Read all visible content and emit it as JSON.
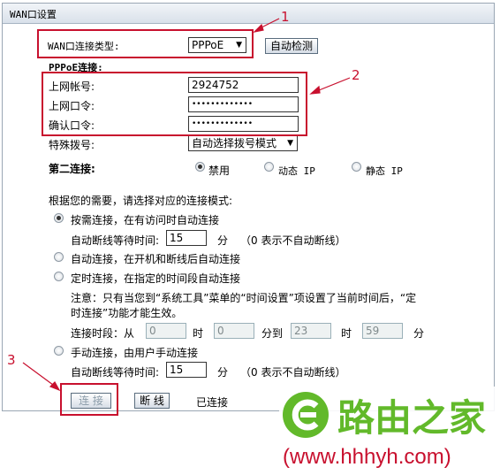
{
  "window": {
    "title": "WAN口设置"
  },
  "wan_type": {
    "label": "WAN口连接类型:",
    "value": "PPPoE",
    "detect_button": "自动检测"
  },
  "pppoe": {
    "section_label": "PPPoE连接:",
    "account_label": "上网帐号:",
    "account_value": "2924752",
    "password_label": "上网口令:",
    "password_value": "•••••••••••••",
    "confirm_label": "确认口令:",
    "confirm_value": "•••••••••••••",
    "dial_label": "特殊拨号:",
    "dial_value": "自动选择拨号模式"
  },
  "second_conn": {
    "label": "第二连接:",
    "options": [
      "禁用",
      "动态 IP",
      "静态 IP"
    ],
    "selected": "禁用"
  },
  "mode": {
    "prompt": "根据您的需要，请选择对应的连接模式:",
    "on_demand": "按需连接，在有访问时自动连接",
    "idle_label": "自动断线等待时间:",
    "idle_value": "15",
    "idle_unit": "分",
    "idle_note": "（0 表示不自动断线）",
    "auto": "自动连接，在开机和断线后自动连接",
    "timed": "定时连接，在指定的时间段自动连接",
    "timed_note_line1": "注意：只有当您到“系统工具”菜单的“时间设置”项设置了当前时间后，“定",
    "timed_note_line2": "时连接”功能才能生效。",
    "period_label": "连接时段：从",
    "period_from_h": "0",
    "period_unit_h": "时",
    "period_from_m": "0",
    "period_to_label": "分到",
    "period_to_h": "23",
    "period_to_m": "59",
    "period_unit_m": "分",
    "manual": "手动连接，由用户手动连接",
    "manual_idle_value": "15"
  },
  "actions": {
    "connect": "连 接",
    "disconnect": "断 线",
    "status": "已连接"
  },
  "annotations": [
    "1",
    "2",
    "3"
  ],
  "watermark": {
    "brand": "路由之家",
    "url": "(www.hhhyh.com)"
  },
  "colors": {
    "annotation": "#c8102e",
    "logo_green": "#62b92a",
    "watermark_text": "#c8102e"
  }
}
